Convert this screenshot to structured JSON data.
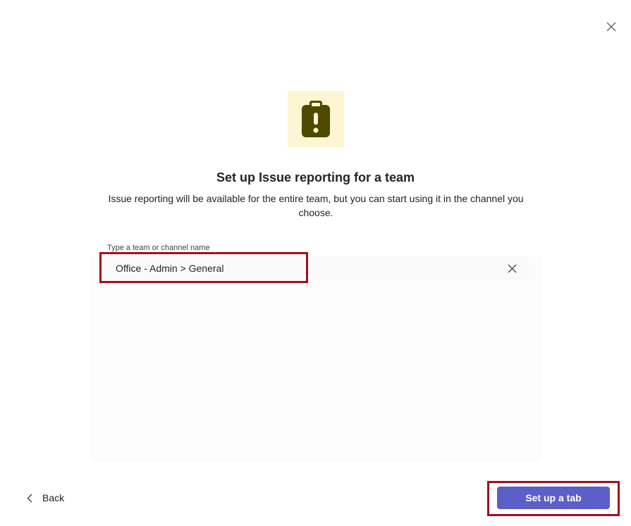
{
  "dialog": {
    "close_icon": "close-icon",
    "app_icon": "clipboard-alert-icon",
    "title": "Set up Issue reporting for a team",
    "description": "Issue reporting will be available for the entire team, but you can start using it in the channel you choose."
  },
  "team_picker": {
    "label": "Type a team or channel name",
    "value": "Office - Admin > General",
    "clear_icon": "clear-icon"
  },
  "footer": {
    "back_label": "Back",
    "back_icon": "chevron-left-icon",
    "primary_label": "Set up a tab"
  },
  "colors": {
    "accent": "#5b5fc7",
    "highlight": "#a0101e",
    "icon_tile": "#fdf6d2",
    "icon_fill": "#4f4a00"
  }
}
